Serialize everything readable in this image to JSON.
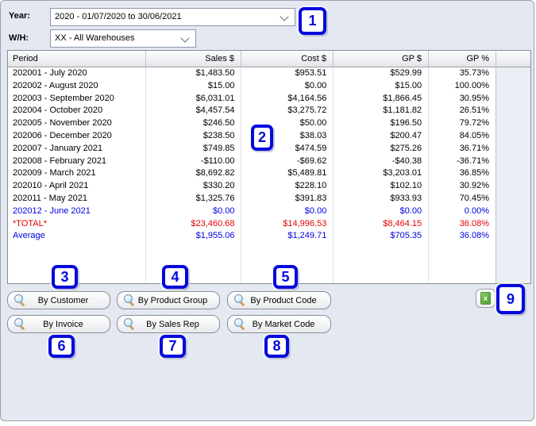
{
  "filters": {
    "year_label": "Year:",
    "year_value": "2020 - 01/07/2020 to 30/06/2021",
    "wh_label": "W/H:",
    "wh_value": "XX - All Warehouses"
  },
  "table": {
    "columns": [
      {
        "label": "Period",
        "align": "left"
      },
      {
        "label": "Sales $",
        "align": "right"
      },
      {
        "label": "Cost $",
        "align": "right"
      },
      {
        "label": "GP $",
        "align": "right"
      },
      {
        "label": "GP %",
        "align": "right"
      }
    ],
    "rows": [
      {
        "tone": "normal",
        "cells": [
          "202001 - July 2020",
          "$1,483.50",
          "$953.51",
          "$529.99",
          "35.73%"
        ]
      },
      {
        "tone": "normal",
        "cells": [
          "202002 - August 2020",
          "$15.00",
          "$0.00",
          "$15.00",
          "100.00%"
        ]
      },
      {
        "tone": "normal",
        "cells": [
          "202003 - September 2020",
          "$6,031.01",
          "$4,164.56",
          "$1,866.45",
          "30.95%"
        ]
      },
      {
        "tone": "normal",
        "cells": [
          "202004 - October 2020",
          "$4,457.54",
          "$3,275.72",
          "$1,181.82",
          "26.51%"
        ]
      },
      {
        "tone": "normal",
        "cells": [
          "202005 - November 2020",
          "$246.50",
          "$50.00",
          "$196.50",
          "79.72%"
        ]
      },
      {
        "tone": "normal",
        "cells": [
          "202006 - December 2020",
          "$238.50",
          "$38.03",
          "$200.47",
          "84.05%"
        ]
      },
      {
        "tone": "normal",
        "cells": [
          "202007 - January 2021",
          "$749.85",
          "$474.59",
          "$275.26",
          "36.71%"
        ]
      },
      {
        "tone": "normal",
        "cells": [
          "202008 - February 2021",
          "-$110.00",
          "-$69.62",
          "-$40.38",
          "-36.71%"
        ]
      },
      {
        "tone": "normal",
        "cells": [
          "202009 - March 2021",
          "$8,692.82",
          "$5,489.81",
          "$3,203.01",
          "36.85%"
        ]
      },
      {
        "tone": "normal",
        "cells": [
          "202010 - April 2021",
          "$330.20",
          "$228.10",
          "$102.10",
          "30.92%"
        ]
      },
      {
        "tone": "normal",
        "cells": [
          "202011 - May 2021",
          "$1,325.76",
          "$391.83",
          "$933.93",
          "70.45%"
        ]
      },
      {
        "tone": "blue",
        "cells": [
          "202012 - June 2021",
          "$0.00",
          "$0.00",
          "$0.00",
          "0.00%"
        ]
      },
      {
        "tone": "red",
        "cells": [
          "*TOTAL*",
          "$23,460.68",
          "$14,996.53",
          "$8,464.15",
          "36.08%"
        ]
      },
      {
        "tone": "blue",
        "cells": [
          "Average",
          "$1,955.06",
          "$1,249.71",
          "$705.35",
          "36.08%"
        ]
      }
    ]
  },
  "drill_buttons": {
    "icon": "magnifier-icon",
    "row1": [
      "By Customer",
      "By Product Group",
      "By Product Code"
    ],
    "row2": [
      "By Invoice",
      "By Sales Rep",
      "By Market Code"
    ]
  },
  "export_button": {
    "icon": "excel-icon",
    "glyph": "x"
  },
  "annotations": {
    "n1": "1",
    "n2": "2",
    "n3": "3",
    "n4": "4",
    "n5": "5",
    "n6": "6",
    "n7": "7",
    "n8": "8",
    "n9": "9"
  },
  "colors": {
    "annotation_blue": "#0509dd",
    "total_red": "#e80000",
    "projection_blue": "#0000e0",
    "panel_bg": "#e3e8f1"
  }
}
